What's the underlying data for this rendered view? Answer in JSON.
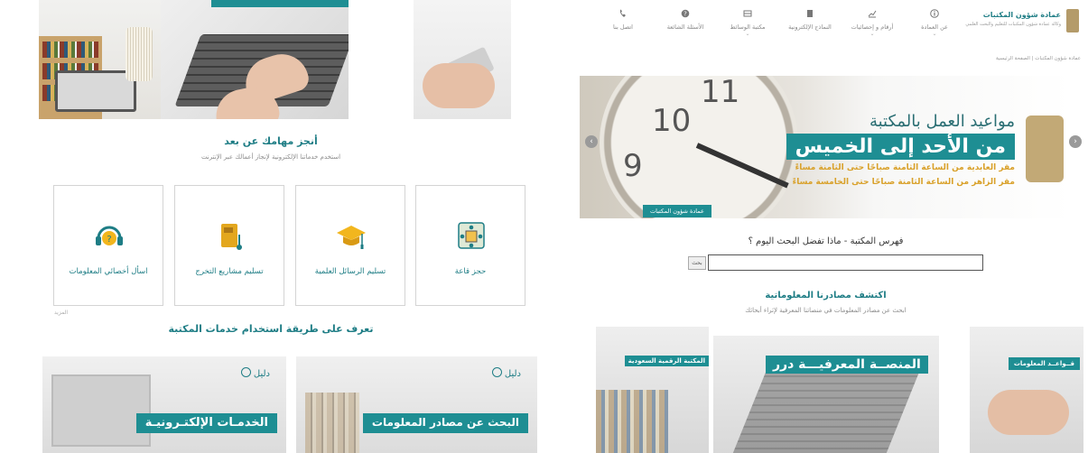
{
  "left": {
    "section1": {
      "title": "أنجز مهامك عن بعد",
      "subtitle": "استخدم خدماتنا الإلكترونية لإنجاز أعمالك عبر الإنترنت"
    },
    "services": [
      {
        "label": "حجز قاعة",
        "icon": "meeting-room-icon"
      },
      {
        "label": "تسليم الرسائل العلمية",
        "icon": "graduation-cap-icon"
      },
      {
        "label": "تسليم مشاريع التخرج",
        "icon": "book-upload-icon"
      },
      {
        "label": "اسأل أخصائي المعلومات",
        "icon": "headset-question-icon"
      }
    ],
    "more_label": "المزيد",
    "section2": {
      "title": "تعرف على طريقة استخدام خدمات المكتبة"
    },
    "guides": [
      {
        "tag": "دليل",
        "title": "البحث عن مصادر المعلومات"
      },
      {
        "tag": "دليل",
        "title": "الخدمـات الإلكتـرونيـة"
      }
    ]
  },
  "right": {
    "logo": {
      "title": "عمادة شؤون المكتبات",
      "subtitle": "وكالة عمادة شؤون المكتبات للتعليم والبحث العلمي"
    },
    "nav": [
      {
        "label": "عن العمادة",
        "icon": "info-icon",
        "dropdown": true
      },
      {
        "label": "أرقام و إحصائيات",
        "icon": "chart-icon",
        "dropdown": true
      },
      {
        "label": "النماذج الإلكترونية",
        "icon": "document-icon",
        "dropdown": false
      },
      {
        "label": "مكتبة الوسائط",
        "icon": "media-icon",
        "dropdown": true
      },
      {
        "label": "الأسئلة الشائعة",
        "icon": "question-icon",
        "dropdown": false
      },
      {
        "label": "اتصل بنا",
        "icon": "phone-icon",
        "dropdown": false
      }
    ],
    "breadcrumb": {
      "home": "الصفحة الرئيسية",
      "separator": "|",
      "current": "عمادة شؤون المكتبات"
    },
    "slider": {
      "title": "مواعيد العمل بالمكتبة",
      "band": "من الأحد إلى الخميس",
      "line1": "مقر العابدية من الساعة الثامنة صباحًا حتى الثامنة مساءً",
      "line2": "مقر الزاهر من الساعة الثامنة صباحًا حتى الخامسة مساءً",
      "caption": "عمادة شؤون المكتبات",
      "clock_numbers": [
        "10",
        "11",
        "9"
      ]
    },
    "catalog": {
      "title": "فهرس المكتبة - ماذا تفضل البحث اليوم ؟",
      "search_value": "",
      "search_button": "بحث"
    },
    "discover": {
      "title": "اكتشف مصادرنا المعلوماتية",
      "subtitle": "ابحث عن مصادر المعلومات في منصاتنا المعرفية لإثراء أبحاثك"
    },
    "resources": [
      {
        "label": "المكتبة الرقمية السعودية"
      },
      {
        "label": "المنصــة المعرفيـــة درر"
      },
      {
        "label": "قــواعــد المعلومات"
      }
    ]
  },
  "colors": {
    "accent": "#1e8e93",
    "accent_text": "#1e7d85",
    "gold": "#d9a12a"
  }
}
